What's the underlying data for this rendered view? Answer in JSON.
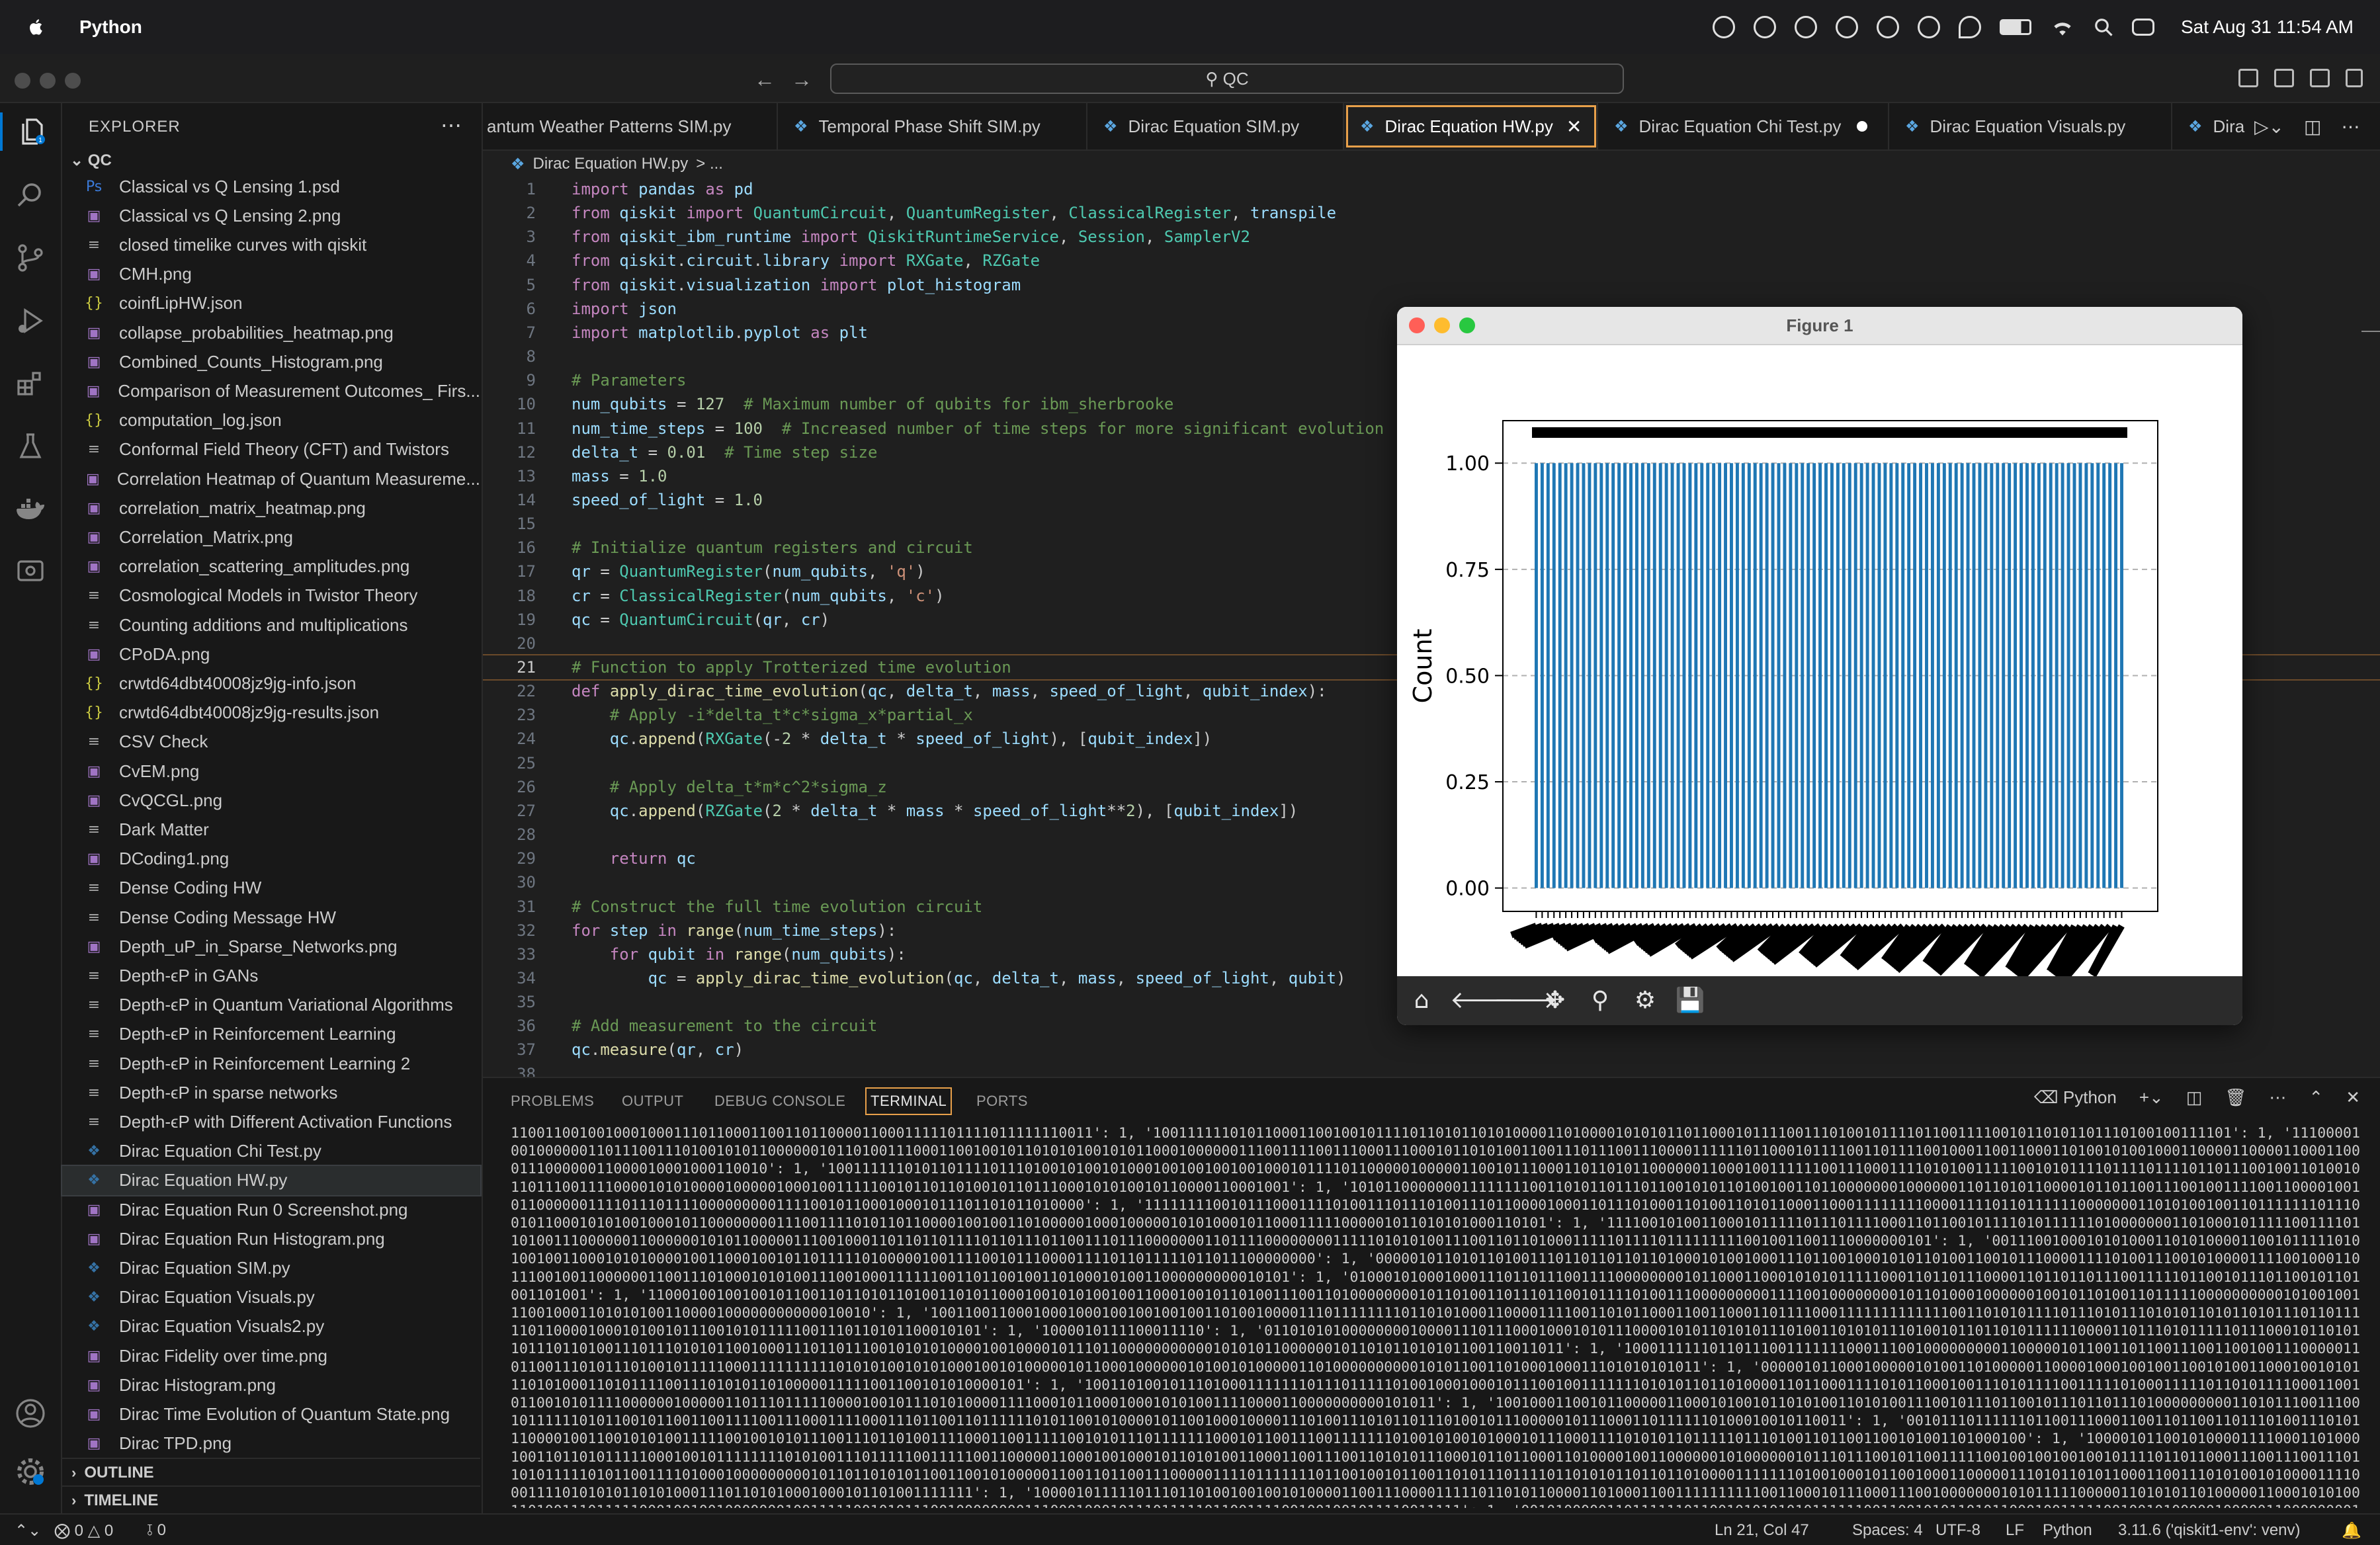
{
  "menubar": {
    "app_name": "Python",
    "clock": "Sat Aug 31  11:54 AM"
  },
  "titlebar": {
    "search": "QC"
  },
  "explorer": {
    "header": "EXPLORER",
    "folder": "QC",
    "files": [
      {
        "name": "Classical vs Q Lensing 1.psd",
        "type": "psd"
      },
      {
        "name": "Classical vs Q Lensing 2.png",
        "type": "img"
      },
      {
        "name": "closed timelike curves with qiskit",
        "type": "txt"
      },
      {
        "name": "CMH.png",
        "type": "img"
      },
      {
        "name": "coinfLipHW.json",
        "type": "json"
      },
      {
        "name": "collapse_probabilities_heatmap.png",
        "type": "img"
      },
      {
        "name": "Combined_Counts_Histogram.png",
        "type": "img"
      },
      {
        "name": "Comparison of Measurement Outcomes_ Firs...",
        "type": "img"
      },
      {
        "name": "computation_log.json",
        "type": "json"
      },
      {
        "name": "Conformal Field Theory (CFT) and Twistors",
        "type": "txt"
      },
      {
        "name": "Correlation Heatmap of Quantum Measureme...",
        "type": "img"
      },
      {
        "name": "correlation_matrix_heatmap.png",
        "type": "img"
      },
      {
        "name": "Correlation_Matrix.png",
        "type": "img"
      },
      {
        "name": "correlation_scattering_amplitudes.png",
        "type": "img"
      },
      {
        "name": "Cosmological Models in Twistor Theory",
        "type": "txt"
      },
      {
        "name": "Counting additions and multiplications",
        "type": "txt"
      },
      {
        "name": "CPoDA.png",
        "type": "img"
      },
      {
        "name": "crwtd64dbt40008jz9jg-info.json",
        "type": "json"
      },
      {
        "name": "crwtd64dbt40008jz9jg-results.json",
        "type": "json"
      },
      {
        "name": "CSV Check",
        "type": "txt"
      },
      {
        "name": "CvEM.png",
        "type": "img"
      },
      {
        "name": "CvQCGL.png",
        "type": "img"
      },
      {
        "name": "Dark Matter",
        "type": "txt"
      },
      {
        "name": "DCoding1.png",
        "type": "img"
      },
      {
        "name": "Dense Coding HW",
        "type": "txt"
      },
      {
        "name": "Dense Coding Message HW",
        "type": "txt"
      },
      {
        "name": "Depth_uP_in_Sparse_Networks.png",
        "type": "img"
      },
      {
        "name": "Depth-ϵP in GANs",
        "type": "txt"
      },
      {
        "name": "Depth-ϵP in Quantum Variational Algorithms",
        "type": "txt"
      },
      {
        "name": "Depth-ϵP in Reinforcement Learning",
        "type": "txt"
      },
      {
        "name": "Depth-ϵP in Reinforcement Learning 2",
        "type": "txt"
      },
      {
        "name": "Depth-ϵP in sparse networks",
        "type": "txt"
      },
      {
        "name": "Depth-ϵP with Different Activation Functions",
        "type": "txt"
      },
      {
        "name": "Dirac Equation Chi Test.py",
        "type": "py"
      },
      {
        "name": "Dirac Equation HW.py",
        "type": "py",
        "selected": true
      },
      {
        "name": "Dirac Equation Run 0 Screenshot.png",
        "type": "img"
      },
      {
        "name": "Dirac Equation Run Histogram.png",
        "type": "img"
      },
      {
        "name": "Dirac Equation SIM.py",
        "type": "py"
      },
      {
        "name": "Dirac Equation Visuals.py",
        "type": "py"
      },
      {
        "name": "Dirac Equation Visuals2.py",
        "type": "py"
      },
      {
        "name": "Dirac Fidelity over time.png",
        "type": "img"
      },
      {
        "name": "Dirac Histogram.png",
        "type": "img"
      },
      {
        "name": "Dirac Time Evolution of Quantum State.png",
        "type": "img"
      },
      {
        "name": "Dirac TPD.png",
        "type": "img"
      }
    ],
    "outline": "OUTLINE",
    "timeline": "TIMELINE"
  },
  "tabs": [
    {
      "label": "antum Weather Patterns SIM.py"
    },
    {
      "label": "Temporal Phase Shift SIM.py"
    },
    {
      "label": "Dirac Equation SIM.py"
    },
    {
      "label": "Dirac Equation HW.py",
      "active": true
    },
    {
      "label": "Dirac Equation Chi Test.py",
      "modified": true
    },
    {
      "label": "Dirac Equation Visuals.py"
    },
    {
      "label": "Dira"
    }
  ],
  "breadcrumb": {
    "file": "Dirac Equation HW.py",
    "rest": "> ..."
  },
  "code_lines": [
    "import pandas as pd",
    "from qiskit import QuantumCircuit, QuantumRegister, ClassicalRegister, transpile",
    "from qiskit_ibm_runtime import QiskitRuntimeService, Session, SamplerV2",
    "from qiskit.circuit.library import RXGate, RZGate",
    "from qiskit.visualization import plot_histogram",
    "import json",
    "import matplotlib.pyplot as plt",
    "",
    "# Parameters",
    "num_qubits = 127  # Maximum number of qubits for ibm_sherbrooke",
    "num_time_steps = 100  # Increased number of time steps for more significant evolution",
    "delta_t = 0.01  # Time step size",
    "mass = 1.0",
    "speed_of_light = 1.0",
    "",
    "# Initialize quantum registers and circuit",
    "qr = QuantumRegister(num_qubits, 'q')",
    "cr = ClassicalRegister(num_qubits, 'c')",
    "qc = QuantumCircuit(qr, cr)",
    "",
    "# Function to apply Trotterized time evolution",
    "def apply_dirac_time_evolution(qc, delta_t, mass, speed_of_light, qubit_index):",
    "    # Apply -i*delta_t*c*sigma_x*partial_x",
    "    qc.append(RXGate(-2 * delta_t * speed_of_light), [qubit_index])",
    "",
    "    # Apply delta_t*m*c^2*sigma_z",
    "    qc.append(RZGate(2 * delta_t * mass * speed_of_light**2), [qubit_index])",
    "",
    "    return qc",
    "",
    "# Construct the full time evolution circuit",
    "for step in range(num_time_steps):",
    "    for qubit in range(num_qubits):",
    "        qc = apply_dirac_time_evolution(qc, delta_t, mass, speed_of_light, qubit)",
    "",
    "# Add measurement to the circuit",
    "qc.measure(qr, cr)",
    ""
  ],
  "figure": {
    "title": "Figure 1"
  },
  "chart_data": {
    "type": "bar",
    "ylabel": "Count",
    "ylim": [
      0,
      1.1
    ],
    "yticks": [
      "0.00",
      "0.25",
      "0.50",
      "0.75",
      "1.00"
    ],
    "ytick_values": [
      0,
      0.25,
      0.5,
      0.75,
      1.0
    ],
    "bar_count": 100,
    "value_each": 1,
    "grid": "y-dashed",
    "xtick_labels": "overlapping bitstrings (illegible)"
  },
  "panel": {
    "tabs": [
      "PROBLEMS",
      "OUTPUT",
      "DEBUG CONSOLE",
      "TERMINAL",
      "PORTS"
    ],
    "active": "TERMINAL",
    "shell": "Python",
    "terminal_text": "11001100100100010001110110001100110110000110001111101111011111110011': 1, '100111111010110001100100101111011010110101000011010000101010110110001011110011101001011110110011110010110101101110100100111101': 1, '11100001001000000110111001110100101011000000101101001110001100100101101010100101011000100000011100111100111000111000101101010011001110111001110000111111011000101111001101111001000110011000110100101001000110000110000110001100011100000011000010001000110010': 1, '100111111010110111101110100101001010001001001001001000101111011000001000001100101110001101101011000000110001001111110011100011110101001111100101011110111101111011011100100110100101101110011110000101010000100000100010011111001011011010010110111000101010010110000110001001': 1, '10101100000001111111100110101101110110010101101001001101100000001000000110110101100001011011001110010011110011000010010110000001111011101111000000000111100101100010001011101101011010000': 1, '11111111001011100011110100111011101001110110000100011011101000110100110101100011000111111110000111101101111110000000110101001001101111111011100101100010101001000101100000000111001111010110110000100100110100000100010000010101000101100011111000001011010101000110101': 1, '11110010100110001011111011101111000110110010111101011111101000000011010001011111001111011010011100000011000000101011000001110010001101101101111011011101100111011100000001101111000000001111101010100111001101101000111110111101111111110010011001110000000101': 1, '00111001000101010001101010000110010111110101001001100010101000010011000100101101111101000001001111001011100001111011011111011011100000000': 1, '00000101101011010011101101101101101000101001000111011001000101011010011001011100001111010011100101000011110010001101110010011000000110011101000101010011100100011111100110110010011010001010011000000000010101': 1, '0100010100010001110110111001111000000001011000110001010101111100011011011100001101101101110011111011001011101100101101001101001': 1, '11000100100100101100110110101101001101011000100101010010011000100101101001110011010000000010110100110111011001011110100111000000000111100100000000101101000100000010010110100110111110000000000101001001110010001101010100110000100000000000010010': 1, '100110011000100010001001001001001101001000011101111111101101010001100001111001101011000110011000110111100011111111111110011010101111011101011101010110101101011101101111101100001000101001011100101011111001110110101100010101': 1, '1000010111100011110': 1, '01101010100000000100001110111000100010101110000101011010101110100110101011101001011011010111111000011011101011111011100010110101101110110100111011101010110010001110110111001010101000010010000101110110000000000010101011000000101101011010101100110011011': 1, '100011111101101110011111110001110010000000001100000101100110110011100110010011100000110110011101011101001011111000111111111101010100101010001001010000010110001000000101001010000011010000000000101011001101000100011101010101011': 1, '0000010110001000001010011010000011000010001001001100101001100010010101110101000110101111001110101011010000011111001100101010000101': 1, '10011010010111010001111111011101111101001000100010111001001111111010101101101000011011000111101011000100111010111100111110100011111011010111100011001011001010111100000010000011011101111100001001011101010000111100010110001000101010011110000110000000000101011': 1, '10010001100101100000110001010010110101001101010011100101110110010111011011101000000000110101110011100101111110101100101100110011110011100011110001110110011011111101011001010000101100100010000111010011101011011101001011100000101110001101111110100010010110011': 1, '00101110111111011001110001100110110011011101001110101110000100110010101001111100100101011100111011010011110001100111110010101110111111100010110011100111111101001010010100010111000111101010110111110111010011011001100101001101000100': 1, '10000101100101000011110001101000100110110101111100010010111111110101001110111110011111001100000110001001000101101010011000110011100110101011100010110110001101000010011000000101000000101110111001011001111100100100100100101111011011000111001110011101101011111010110011110100010000000001011011010101100110010100000110011011001110000011110111111101100100101100110101110111101101010110110110100001111111010010001011001000110000011101011010110001100111010100101000011110001111010101011010100011101101010001000101101001111111': 1, '10000101111101110110100100100101000011001110000111110110101100001101000110011111111110011000101110001110010000000101011111000001101010110100000110001010100110100111011111000100100100000001001111100101011100100000000111000100010111011111011001111001001001011110011111': 1, '0010100000110111111011001010101010111111001100101011010110001001111100100101000001000001100000000100101100001001111001100001001000111111111000000011110110111111100010011100001001000000011100100010111111010001000100010111111111111111001011101110001010100000010000110101001': 1, '1100010100010010101101110100010100001000110101001001011101010010011011101111000101100011010011001010101110001001011110101101010111011011011111001000011000100110110101101100011111000101110110100100100100001010011010110110010001101110011111110101001001101100111010010110001110111101011100100110000': 1}"
  },
  "statusbar": {
    "errors": "0",
    "warnings": "0",
    "ports": "0",
    "position": "Ln 21, Col 47",
    "spaces": "Spaces: 4",
    "encoding": "UTF-8",
    "eol": "LF",
    "language": "Python",
    "interpreter": "3.11.6 ('qiskit1-env': venv)"
  }
}
